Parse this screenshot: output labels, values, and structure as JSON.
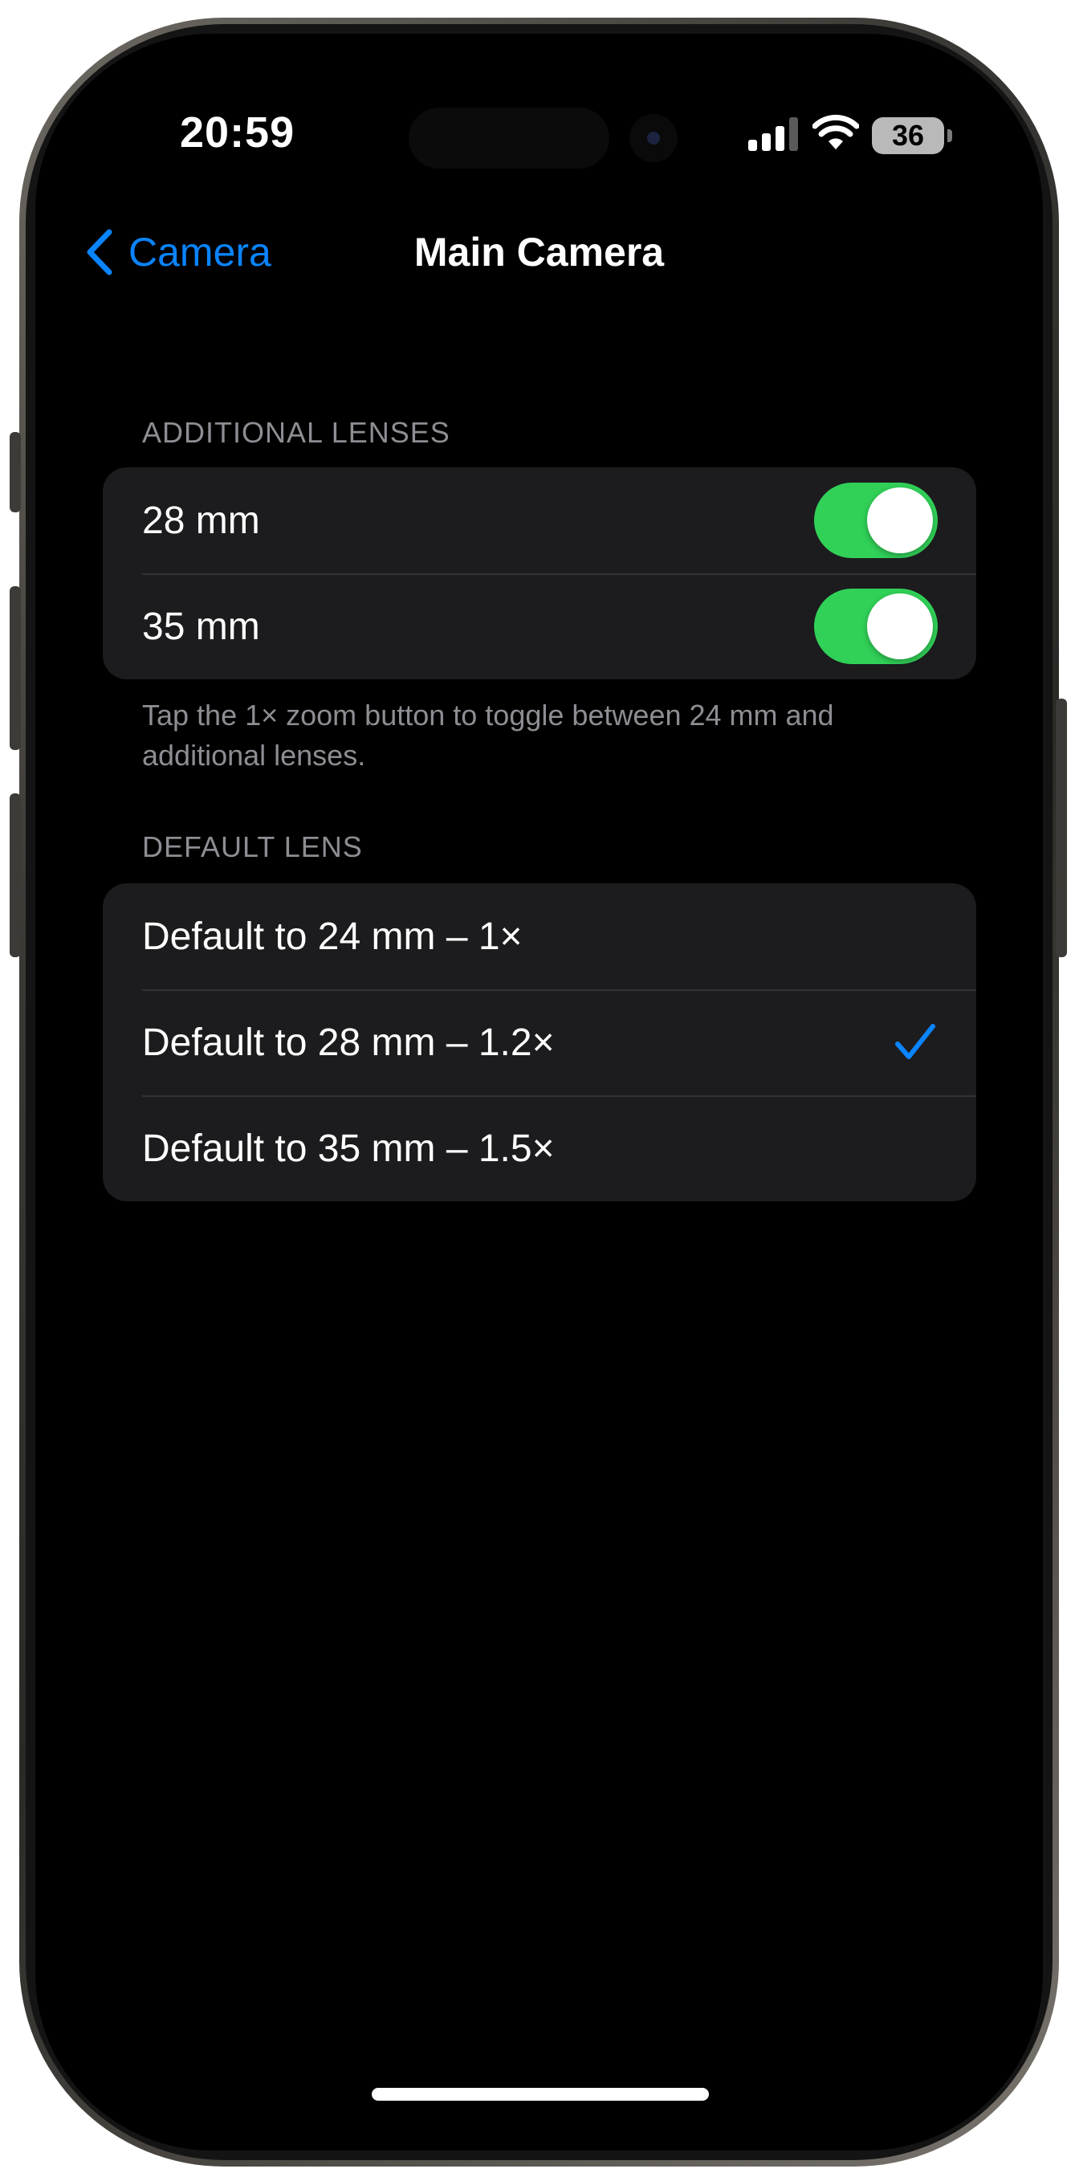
{
  "status_bar": {
    "time": "20:59",
    "battery": "36"
  },
  "nav": {
    "back_label": "Camera",
    "title": "Main Camera"
  },
  "additional_lenses": {
    "header": "ADDITIONAL LENSES",
    "items": [
      {
        "label": "28 mm",
        "enabled": true
      },
      {
        "label": "35 mm",
        "enabled": true
      }
    ],
    "footer": "Tap the 1× zoom button to toggle between 24 mm and additional lenses."
  },
  "default_lens": {
    "header": "DEFAULT LENS",
    "options": [
      {
        "label": "Default to 24 mm – 1×",
        "selected": false
      },
      {
        "label": "Default to 28 mm – 1.2×",
        "selected": true
      },
      {
        "label": "Default to 35 mm – 1.5×",
        "selected": false
      }
    ]
  },
  "colors": {
    "accent": "#0a84ff",
    "toggle_on": "#31d158",
    "group_bg": "#1c1c1e",
    "secondary_text": "#8d8d93"
  },
  "icons": [
    "chevron-left-icon",
    "signal-icon",
    "wifi-icon",
    "battery-icon",
    "checkmark-icon"
  ]
}
